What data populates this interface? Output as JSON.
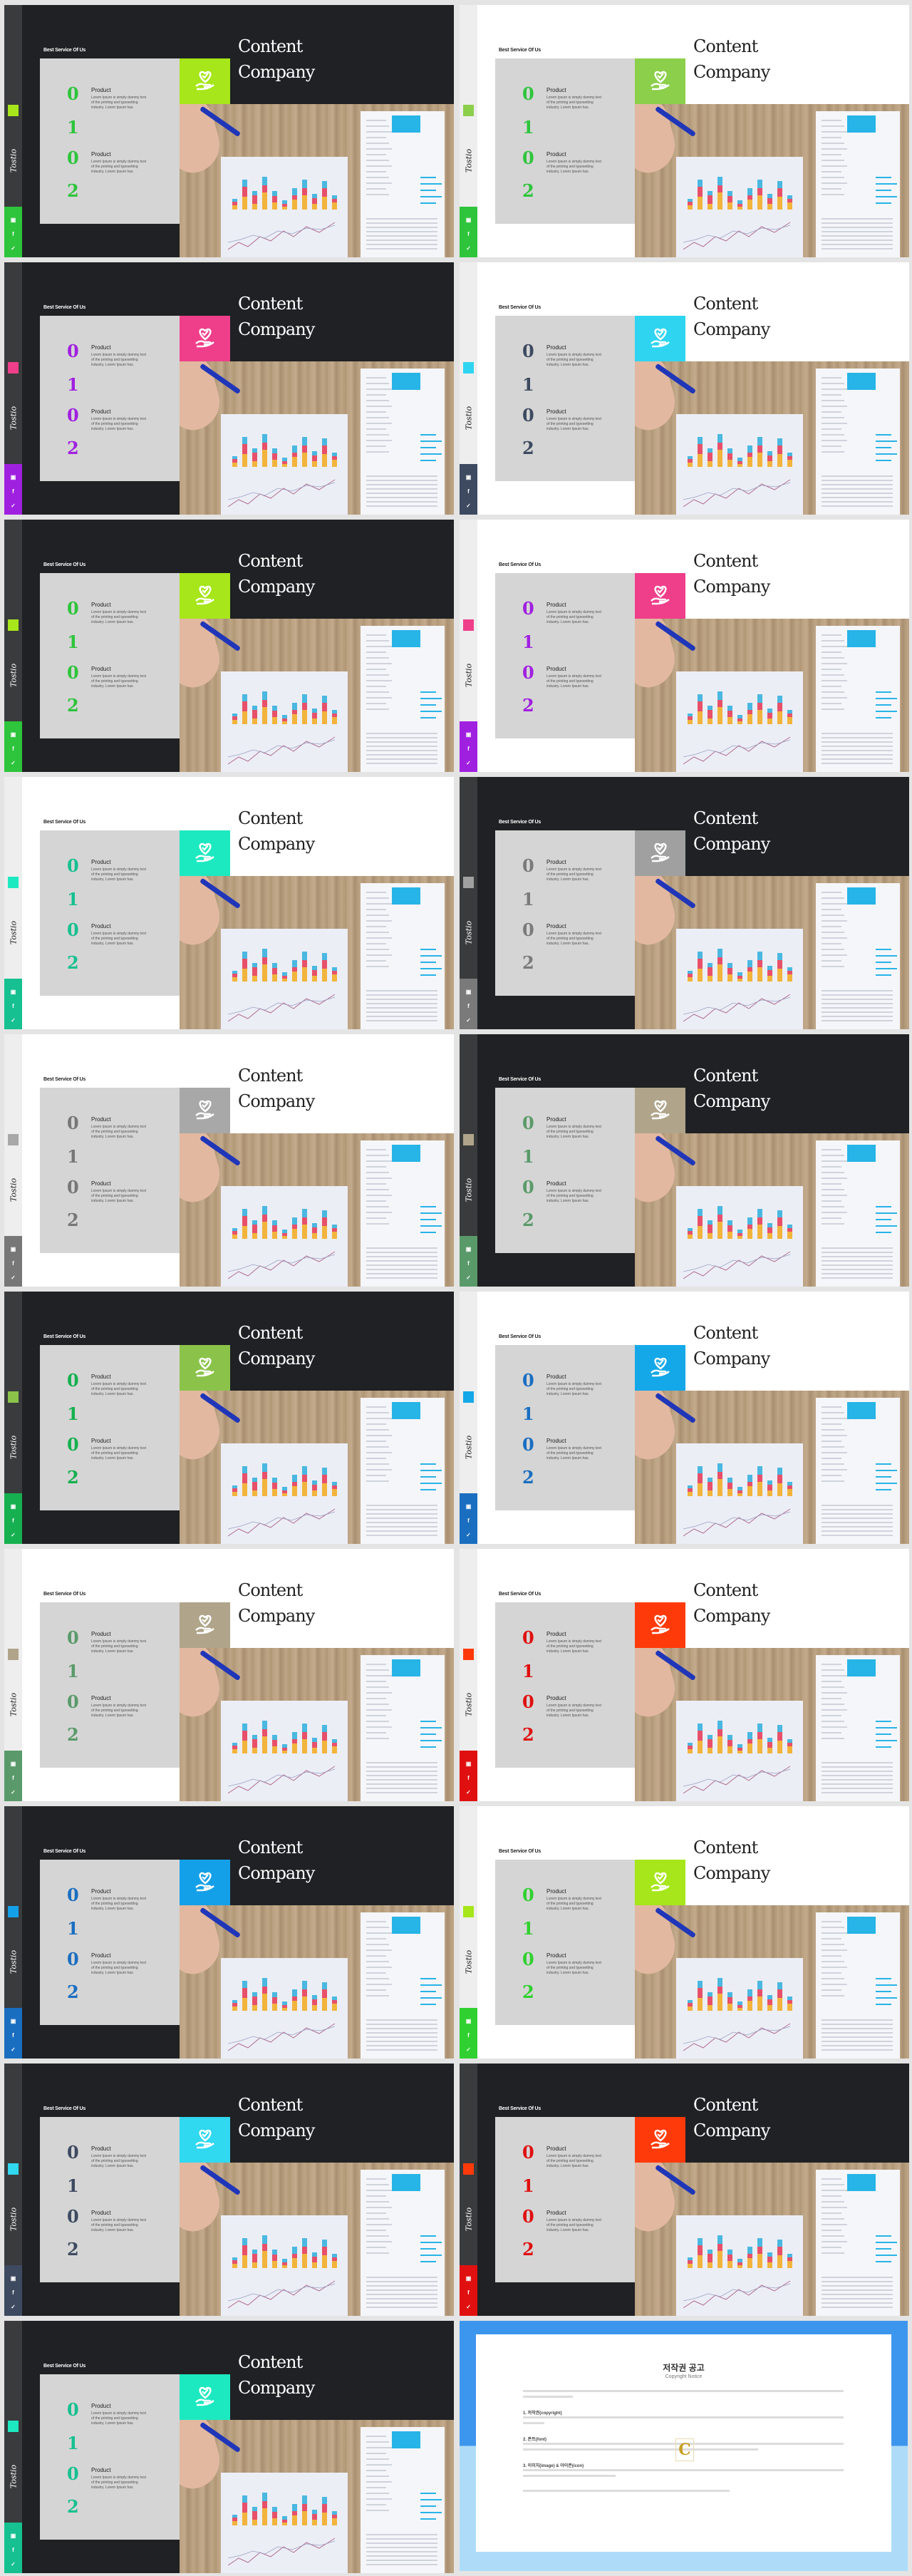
{
  "slide_content": {
    "service_label": "Best Service Of Us",
    "title_line1": "Content",
    "title_line2": "Company",
    "numbers": [
      "0",
      "1",
      "0",
      "2"
    ],
    "product_label": "Product",
    "product_text": "Lorem Ipsum is simply dummy text of the printing and typesetting industry. Lorem Ipsum has.",
    "brand_script": "Tostio",
    "accent_icon": "heart-hand-icon",
    "social_icons": [
      "youtube-icon",
      "facebook-icon",
      "twitter-icon"
    ]
  },
  "slides": [
    {
      "theme": "dark",
      "accent": "#a6e61a",
      "number_color": "#2ec43c"
    },
    {
      "theme": "light",
      "accent": "#8ccf4a",
      "number_color": "#2ec43c"
    },
    {
      "theme": "dark",
      "accent": "#ef3f8a",
      "number_color": "#a020e0"
    },
    {
      "theme": "light",
      "accent": "#2fd5f0",
      "number_color": "#3d4a60"
    },
    {
      "theme": "dark",
      "accent": "#a6e61a",
      "number_color": "#2ec43c"
    },
    {
      "theme": "light",
      "accent": "#ef3f8a",
      "number_color": "#a020e0"
    },
    {
      "theme": "light",
      "accent": "#1de9c0",
      "number_color": "#16c090"
    },
    {
      "theme": "dark",
      "accent": "#a0a0a0",
      "number_color": "#7a7a7a"
    },
    {
      "theme": "light",
      "accent": "#a8a8a8",
      "number_color": "#777777"
    },
    {
      "theme": "dark",
      "accent": "#b0a58a",
      "number_color": "#5a9a6a"
    },
    {
      "theme": "dark",
      "accent": "#8bc34a",
      "number_color": "#16b050"
    },
    {
      "theme": "light",
      "accent": "#14a8e8",
      "number_color": "#1a6ec0"
    },
    {
      "theme": "light",
      "accent": "#b0a58a",
      "number_color": "#5a9a6a"
    },
    {
      "theme": "light",
      "accent": "#ff3a0a",
      "number_color": "#e01010"
    },
    {
      "theme": "dark",
      "accent": "#14a0e8",
      "number_color": "#1a6ec0"
    },
    {
      "theme": "light",
      "accent": "#a6e61a",
      "number_color": "#30d030"
    },
    {
      "theme": "dark",
      "accent": "#30d8f0",
      "number_color": "#3d4a60"
    },
    {
      "theme": "dark",
      "accent": "#ff3a0a",
      "number_color": "#e01010"
    },
    {
      "theme": "dark",
      "accent": "#1de9c0",
      "number_color": "#16c090"
    }
  ],
  "copyright": {
    "title": "저작권 공고",
    "subtitle": "Copyright Notice",
    "sections": [
      "1. 저작권(copyright)",
      "2. 폰트(font)",
      "3. 이미지(image) & 아이콘(icon)"
    ],
    "logo_letter": "C"
  }
}
